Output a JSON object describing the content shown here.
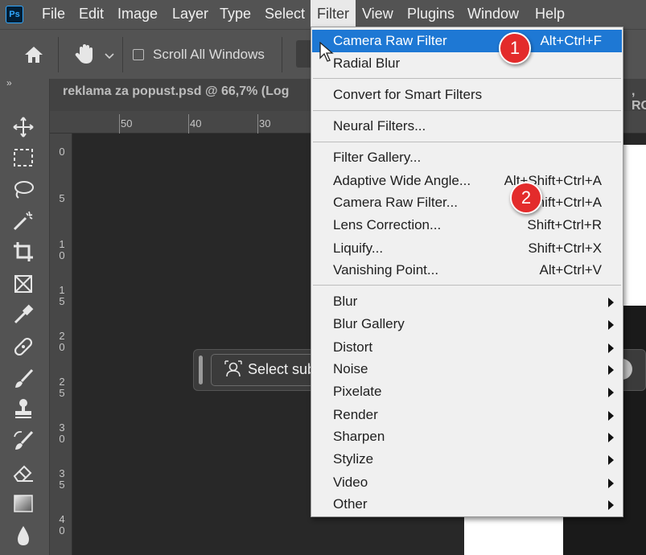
{
  "app": {
    "logo": "Ps"
  },
  "menubar": {
    "items": [
      "File",
      "Edit",
      "Image",
      "Layer",
      "Type",
      "Select",
      "Filter",
      "View",
      "Plugins",
      "Window",
      "Help"
    ],
    "active": "Filter"
  },
  "options": {
    "scroll_all_windows": "Scroll All Windows",
    "scroll_all_checked": false
  },
  "toolbar": {
    "collapse": "»"
  },
  "document": {
    "tab_title": "reklama za popust.psd @ 66,7% (Log",
    "tab_right": ", RC"
  },
  "rulers": {
    "horizontal": [
      "50",
      "40",
      "30"
    ],
    "vertical": [
      "0",
      "5",
      "1\n0",
      "1\n5",
      "2\n0",
      "2\n5",
      "3\n0",
      "3\n5",
      "4\n0"
    ]
  },
  "taskbar": {
    "select_subject": "Select sub"
  },
  "filter_menu": {
    "groups": [
      [
        {
          "label": "Camera Raw Filter",
          "shortcut": "Alt+Ctrl+F",
          "highlighted": true
        },
        {
          "label": "Radial Blur",
          "shortcut": ""
        }
      ],
      [
        {
          "label": "Convert for Smart Filters",
          "shortcut": ""
        }
      ],
      [
        {
          "label": "Neural Filters...",
          "shortcut": ""
        }
      ],
      [
        {
          "label": "Filter Gallery...",
          "shortcut": ""
        },
        {
          "label": "Adaptive Wide Angle...",
          "shortcut": "Alt+Shift+Ctrl+A"
        },
        {
          "label": "Camera Raw Filter...",
          "shortcut": "Shift+Ctrl+A"
        },
        {
          "label": "Lens Correction...",
          "shortcut": "Shift+Ctrl+R"
        },
        {
          "label": "Liquify...",
          "shortcut": "Shift+Ctrl+X"
        },
        {
          "label": "Vanishing Point...",
          "shortcut": "Alt+Ctrl+V"
        }
      ],
      [
        {
          "label": "Blur",
          "submenu": true
        },
        {
          "label": "Blur Gallery",
          "submenu": true
        },
        {
          "label": "Distort",
          "submenu": true
        },
        {
          "label": "Noise",
          "submenu": true
        },
        {
          "label": "Pixelate",
          "submenu": true
        },
        {
          "label": "Render",
          "submenu": true
        },
        {
          "label": "Sharpen",
          "submenu": true
        },
        {
          "label": "Stylize",
          "submenu": true
        },
        {
          "label": "Video",
          "submenu": true
        },
        {
          "label": "Other",
          "submenu": true
        }
      ]
    ]
  },
  "annotations": [
    "1",
    "2"
  ],
  "colors": {
    "highlight": "#1e78d4",
    "badge": "#e32b2b",
    "menu_bg": "#f0f0f0",
    "chrome": "#535353"
  },
  "icons": [
    "ps-logo-icon",
    "home-icon",
    "hand-icon",
    "chevron-down-icon",
    "move-icon",
    "marquee-icon",
    "lasso-icon",
    "magic-wand-icon",
    "crop-icon",
    "frame-icon",
    "eyedropper-icon",
    "healing-icon",
    "brush-icon",
    "stamp-icon",
    "history-brush-icon",
    "eraser-icon",
    "gradient-icon",
    "blur-drop-icon",
    "person-icon",
    "cursor-icon",
    "submenu-arrow-icon"
  ]
}
